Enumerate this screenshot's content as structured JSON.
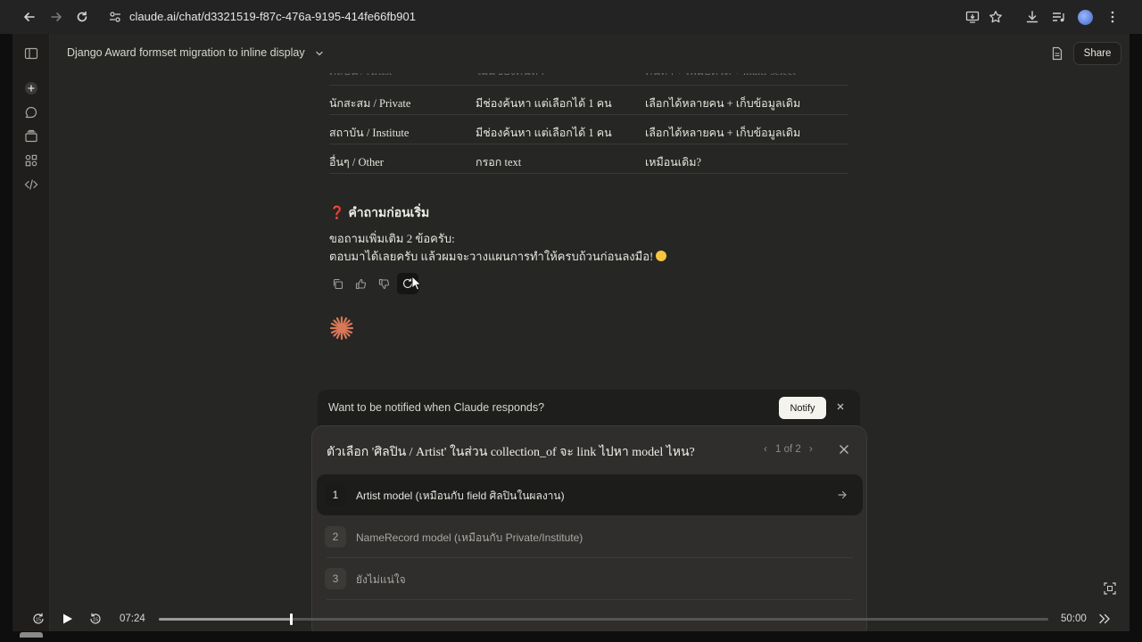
{
  "browser": {
    "url": "claude.ai/chat/d3321519-f87c-476a-9195-414fe66fb901"
  },
  "topbar": {
    "title": "Django Award formset migration to inline display",
    "share_label": "Share"
  },
  "table": {
    "faded_row": [
      "ศิลปิน / Artist",
      "ไม่มีช่องค้นหา",
      "ค้นหา + เพิ่มอัตโต + multi-select"
    ],
    "rows": [
      [
        "นักสะสม / Private",
        "มีช่องค้นหา แต่เลือกได้ 1 คน",
        "เลือกได้หลายคน + เก็บข้อมูลเดิม"
      ],
      [
        "สถาบัน / Institute",
        "มีช่องค้นหา แต่เลือกได้ 1 คน",
        "เลือกได้หลายคน + เก็บข้อมูลเดิม"
      ],
      [
        "อื่นๆ / Other",
        "กรอก text",
        "เหมือนเดิม?"
      ]
    ]
  },
  "message": {
    "heading_mark": "❓",
    "heading": "คำถามก่อนเริ่ม",
    "line1": "ขอถามเพิ่มเติม 2 ข้อครับ:",
    "line2": "ตอบมาได้เลยครับ แล้วผมจะวางแผนการทำให้ครบถ้วนก่อนลงมือ!"
  },
  "notify": {
    "text": "Want to be notified when Claude responds?",
    "button": "Notify"
  },
  "question": {
    "title": "ตัวเลือก 'ศิลปิน / Artist' ในส่วน collection_of จะ link ไปหา model ไหน?",
    "pager": "1 of 2",
    "options": [
      {
        "num": "1",
        "label": "Artist model (เหมือนกับ field ศิลปินในผลงาน)"
      },
      {
        "num": "2",
        "label": "NameRecord model (เหมือนกับ Private/Institute)"
      },
      {
        "num": "3",
        "label": "ยังไม่แน่ใจ"
      }
    ]
  },
  "video": {
    "current": "07:24",
    "duration": "50:00",
    "progress": 0.148
  },
  "colors": {
    "accent": "#d97757",
    "background": "#262624"
  }
}
